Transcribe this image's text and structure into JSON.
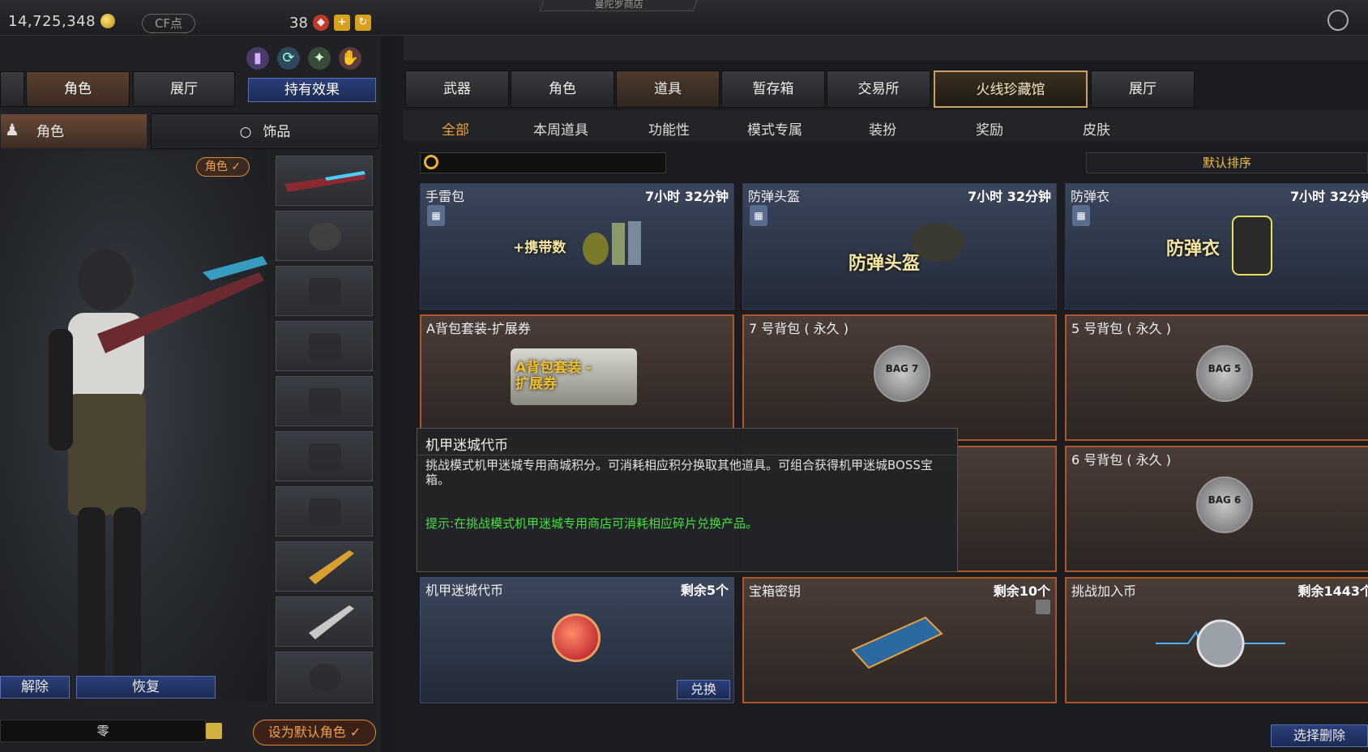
{
  "topbar": {
    "gold": "14,725,348",
    "cf_points_label": "CF点",
    "level": "38",
    "center_title": "曼陀罗商店"
  },
  "left": {
    "tabs": [
      "角色",
      "展厅"
    ],
    "hold_effect": "持有效果",
    "sub_tabs": [
      "角色",
      "饰品"
    ],
    "role_tag": "角色 ✓",
    "release_button": "解除",
    "restore_button": "恢复",
    "name_field": "零",
    "default_role_button": "设为默认角色 ✓"
  },
  "main_tabs": [
    "武器",
    "角色",
    "道具",
    "暂存箱",
    "交易所",
    "火线珍藏馆",
    "展厅"
  ],
  "sub_nav": [
    "全部",
    "本周道具",
    "功能性",
    "模式专属",
    "装扮",
    "奖励",
    "皮肤"
  ],
  "search": {
    "placeholder": ""
  },
  "sort_button": "默认排序",
  "items": [
    {
      "name": "手雷包",
      "time": "7小时 32分钟",
      "art": "+携带数"
    },
    {
      "name": "防弹头盔",
      "time": "7小时 32分钟",
      "art": "防弹头盔"
    },
    {
      "name": "防弹衣",
      "time": "7小时 32分钟",
      "art": "防弹衣"
    },
    {
      "name": "A背包套装-扩展券",
      "time": "",
      "art": "A背包套装 -扩展券"
    },
    {
      "name": "7 号背包 ( 永久 )",
      "time": "",
      "art": "BAG 7"
    },
    {
      "name": "5 号背包 ( 永久 )",
      "time": "",
      "art": "BAG 5"
    },
    {
      "name": "6 号背包 ( 永久 )",
      "time": "",
      "art": "BAG 6"
    },
    {
      "name": "机甲迷城代币",
      "time": "剩余5个",
      "art": "",
      "action": "兑换"
    },
    {
      "name": "宝箱密钥",
      "time": "剩余10个",
      "art": ""
    },
    {
      "name": "挑战加入币",
      "time": "剩余1443个",
      "art": ""
    }
  ],
  "tooltip": {
    "title": "机甲迷城代币",
    "description": "挑战模式机甲迷城专用商城积分。可消耗相应积分换取其他道具。可组合获得机甲迷城BOSS宝箱。",
    "tip": "提示:在挑战模式机甲迷城专用商店可消耗相应碎片兑换产品。"
  },
  "delete_button": "选择删除",
  "colors": {
    "accent_orange": "#f0a030",
    "tip_green": "#48e040",
    "card_border_brown": "#b0552a",
    "blue_button": "#2b3f7a"
  }
}
